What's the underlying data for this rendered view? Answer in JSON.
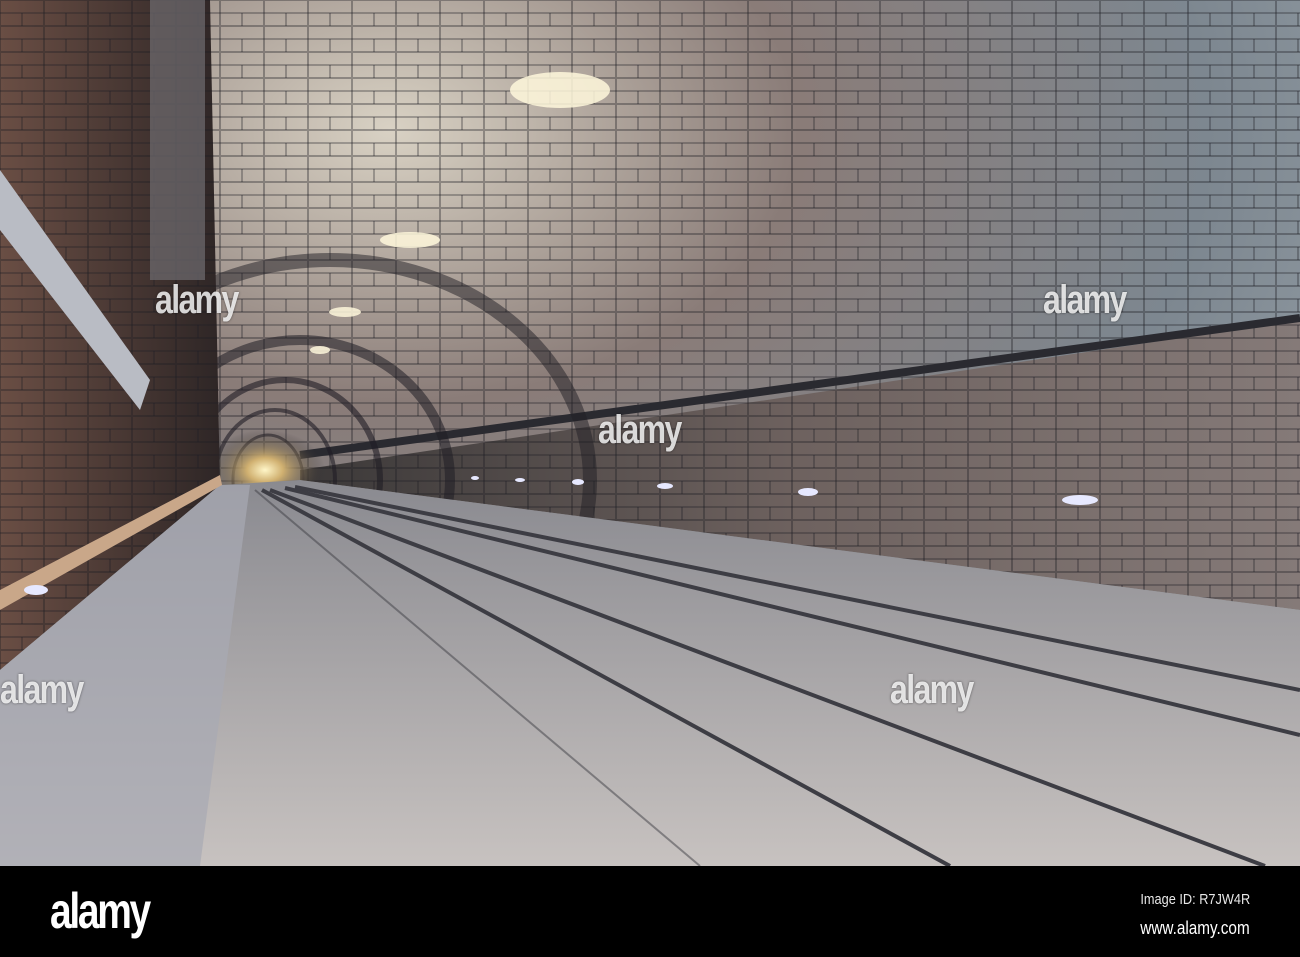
{
  "photo": {
    "subject": "Lit stone-brick arched tram tunnel with rails and walkway",
    "watermarks": [
      "alamy",
      "alamy",
      "alamy",
      "alamy",
      "alamy"
    ]
  },
  "footer": {
    "logo": "alamy",
    "image_id": "Image ID: R7JW4R",
    "url": "www.alamy.com"
  }
}
